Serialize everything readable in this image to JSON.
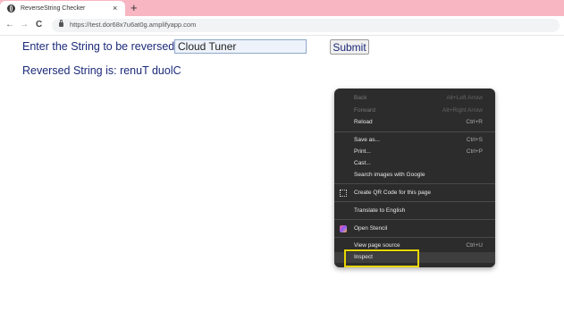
{
  "browser": {
    "tab_title": "ReverseString Checker",
    "tab_close": "×",
    "new_tab": "+",
    "url": "https://test.dor68x7u6at0g.amplifyapp.com"
  },
  "page": {
    "prompt_label": "Enter the String to be reversed",
    "input_value": "Cloud Tuner",
    "submit_label": "Submit",
    "result_text": "Reversed String is: renuT duolC"
  },
  "context_menu": {
    "items": [
      {
        "label": "Back",
        "shortcut": "Alt+Left Arrow",
        "enabled": false
      },
      {
        "label": "Forward",
        "shortcut": "Alt+Right Arrow",
        "enabled": false
      },
      {
        "label": "Reload",
        "shortcut": "Ctrl+R",
        "enabled": true
      },
      {
        "label": "Save as...",
        "shortcut": "Ctrl+S",
        "enabled": true
      },
      {
        "label": "Print...",
        "shortcut": "Ctrl+P",
        "enabled": true
      },
      {
        "label": "Cast...",
        "shortcut": "",
        "enabled": true
      },
      {
        "label": "Search images with Google",
        "shortcut": "",
        "enabled": true
      },
      {
        "label": "Create QR Code for this page",
        "shortcut": "",
        "enabled": true
      },
      {
        "label": "Translate to English",
        "shortcut": "",
        "enabled": true
      },
      {
        "label": "Open Stencil",
        "shortcut": "",
        "enabled": true
      },
      {
        "label": "View page source",
        "shortcut": "Ctrl+U",
        "enabled": true
      },
      {
        "label": "Inspect",
        "shortcut": "",
        "enabled": true,
        "highlighted": true
      }
    ]
  },
  "colors": {
    "tab_strip": "#f7b6c2",
    "page_text": "#1c2a7a",
    "menu_bg": "#2c2c2c",
    "highlight_box": "#e8d500"
  },
  "icons": [
    "globe-icon",
    "close-icon",
    "plus-icon",
    "back-arrow-icon",
    "forward-arrow-icon",
    "reload-icon",
    "lock-icon",
    "qr-code-icon",
    "stencil-icon"
  ]
}
